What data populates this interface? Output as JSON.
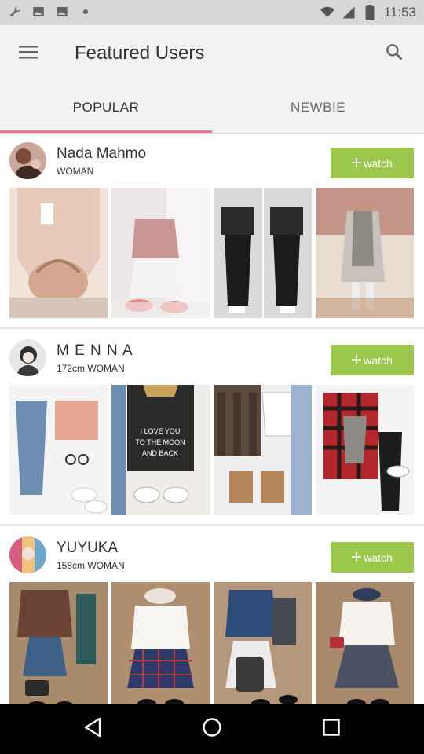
{
  "status_bar": {
    "time": "11:53",
    "icons": [
      "wrench-icon",
      "image-icon",
      "image-icon",
      "notification-dot-icon",
      "wifi-icon",
      "signal-icon",
      "battery-icon"
    ]
  },
  "app_bar": {
    "title": "Featured Users",
    "menu_icon": "hamburger-menu-icon",
    "search_icon": "search-icon"
  },
  "tabs": [
    {
      "label": "POPULAR",
      "selected": true
    },
    {
      "label": "NEWBIE",
      "selected": false
    }
  ],
  "colors": {
    "accent": "#e8758f",
    "watch_button": "#9bc84c",
    "status_bar": "#d7d7d7",
    "app_bar": "#f2f2f2"
  },
  "users": [
    {
      "name": "Nada Mahmo",
      "meta": "WOMAN",
      "watch_label": "watch",
      "photos": [
        "pink sweater with bag",
        "pink top with sneakers",
        "black jeans outfits",
        "grey cardigan outfit"
      ]
    },
    {
      "name": "M E N N A",
      "meta": "172cm  WOMAN",
      "watch_label": "watch",
      "photos": [
        "jeans and sweater flatlay",
        "slogan tee flatlay",
        "plaid shirt flatlay",
        "red plaid flatlay"
      ]
    },
    {
      "name": "YUYUKA",
      "meta": "158cm  WOMAN",
      "watch_label": "watch",
      "photos": [
        "brown sweater and skirt flatlay",
        "white sweater plaid skirt flatlay",
        "denim jacket flatlay",
        "white top skirt flatlay"
      ]
    }
  ],
  "nav_bar": {
    "icons": [
      "back-icon",
      "home-icon",
      "recents-icon"
    ]
  }
}
